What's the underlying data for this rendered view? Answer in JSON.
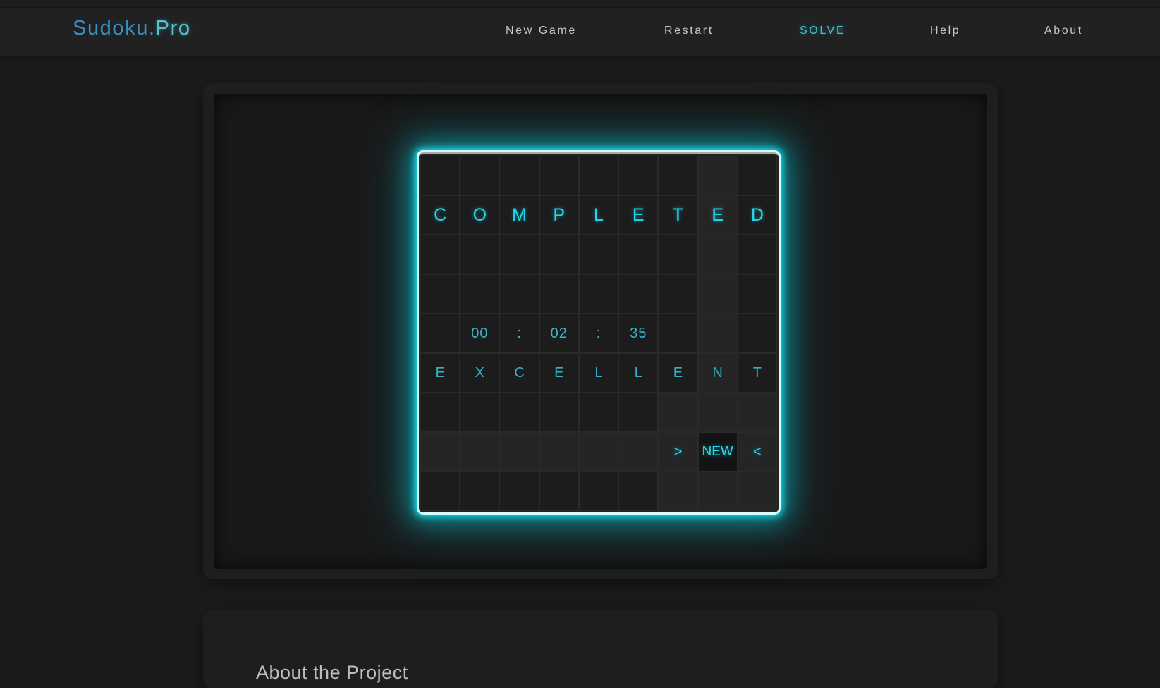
{
  "logo": {
    "main": "Sudoku.",
    "accent": "Pro"
  },
  "nav": {
    "new_game": "New Game",
    "restart": "Restart",
    "solve": "SOLVE",
    "help": "Help",
    "about": "About"
  },
  "board": {
    "completed": [
      "C",
      "O",
      "M",
      "P",
      "L",
      "E",
      "T",
      "E",
      "D"
    ],
    "timer": {
      "hours": "00",
      "sep1": ":",
      "minutes": "02",
      "sep2": ":",
      "seconds": "35"
    },
    "excellent": [
      "E",
      "X",
      "C",
      "E",
      "L",
      "L",
      "E",
      "N",
      "T"
    ],
    "controls": {
      "next": ">",
      "new": "NEW",
      "prev": "<"
    }
  },
  "about": {
    "title": "About the Project"
  },
  "colors": {
    "accent": "#22d8ea",
    "background": "#1b1b1b",
    "logo": "#3a8fbf"
  }
}
